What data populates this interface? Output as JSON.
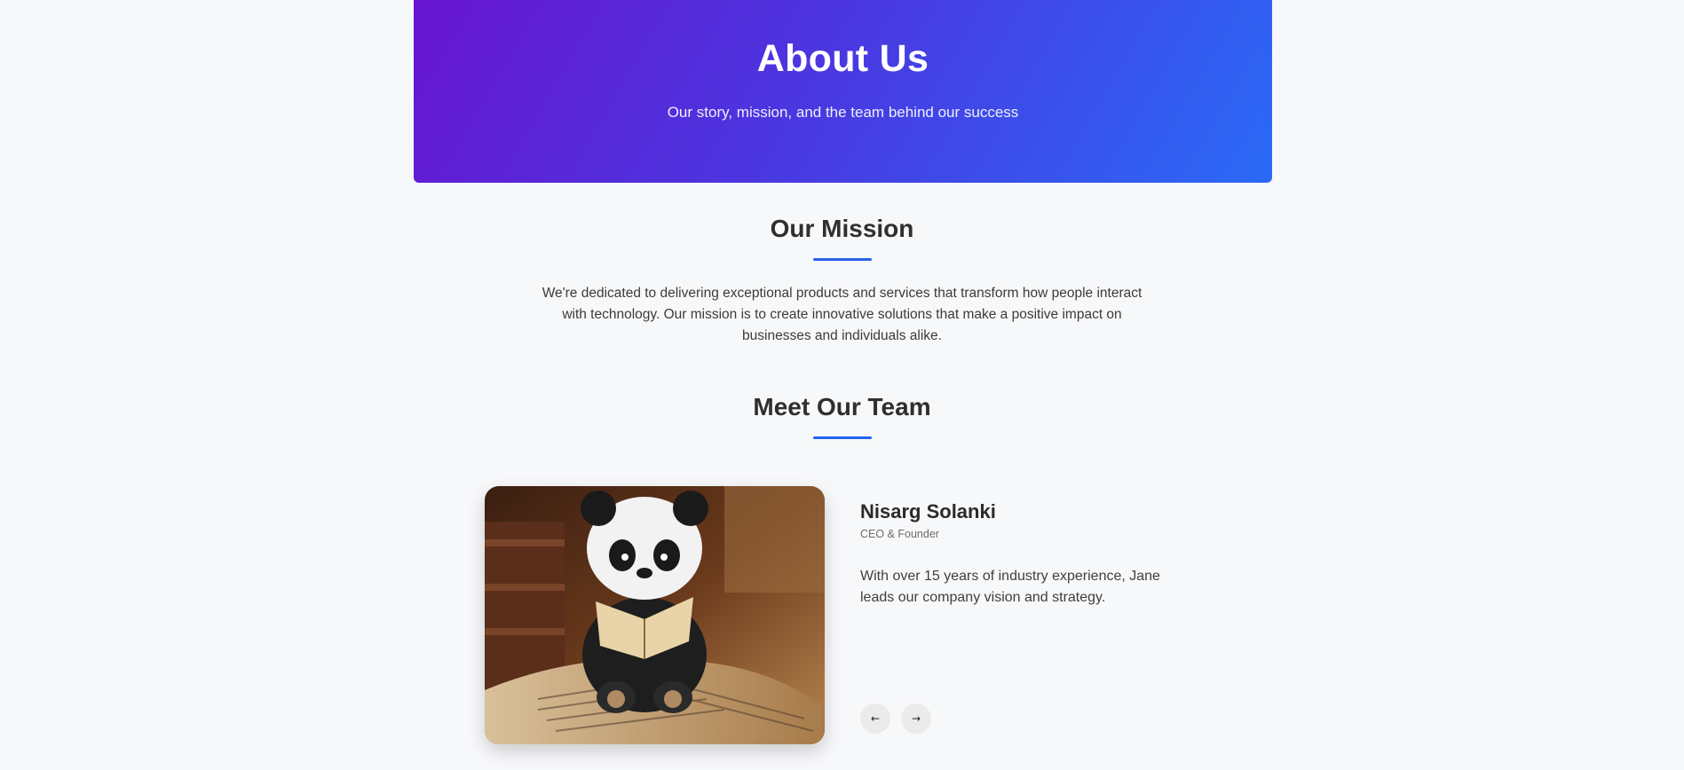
{
  "hero": {
    "title": "About Us",
    "subtitle": "Our story, mission, and the team behind our success",
    "gradient_start": "#6815cf",
    "gradient_end": "#2a6af6"
  },
  "mission": {
    "title": "Our Mission",
    "text": "We're dedicated to delivering exceptional products and services that transform how people interact with technology. Our mission is to create innovative solutions that make a positive impact on businesses and individuals alike."
  },
  "team": {
    "title": "Meet Our Team",
    "member": {
      "name": "Nisarg Solanki",
      "role": "CEO & Founder",
      "bio": "With over 15 years of industry experience, Jane leads our company vision and strategy.",
      "photo_icon": "panda-reading-book-photo"
    },
    "prev_icon": "arrow-left-icon",
    "next_icon": "arrow-right-icon",
    "prev_glyph": "←",
    "next_glyph": "→"
  },
  "colors": {
    "accent": "#2563eb",
    "background": "#f7f8fa"
  }
}
